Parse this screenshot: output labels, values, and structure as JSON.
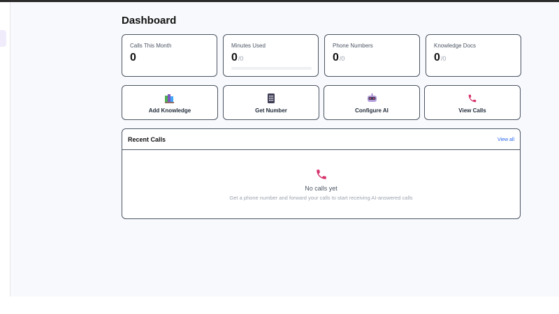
{
  "page": {
    "title": "Dashboard"
  },
  "stats": [
    {
      "label": "Calls This Month",
      "value": "0",
      "total": ""
    },
    {
      "label": "Minutes Used",
      "value": "0",
      "total": "/0",
      "progress": 0
    },
    {
      "label": "Phone Numbers",
      "value": "0",
      "total": "/0"
    },
    {
      "label": "Knowledge Docs",
      "value": "0",
      "total": "/0"
    }
  ],
  "actions": [
    {
      "label": "Add Knowledge",
      "icon": "books-icon"
    },
    {
      "label": "Get Number",
      "icon": "phone-keypad-icon"
    },
    {
      "label": "Configure AI",
      "icon": "robot-icon"
    },
    {
      "label": "View Calls",
      "icon": "phone-icon"
    }
  ],
  "recent_calls": {
    "title": "Recent Calls",
    "view_all": "View all",
    "empty_title": "No calls yet",
    "empty_subtitle": "Get a phone number and forward your calls to start receiving AI-answered calls"
  },
  "colors": {
    "accent_link": "#2563eb",
    "phone_icon": "#d6336c"
  }
}
